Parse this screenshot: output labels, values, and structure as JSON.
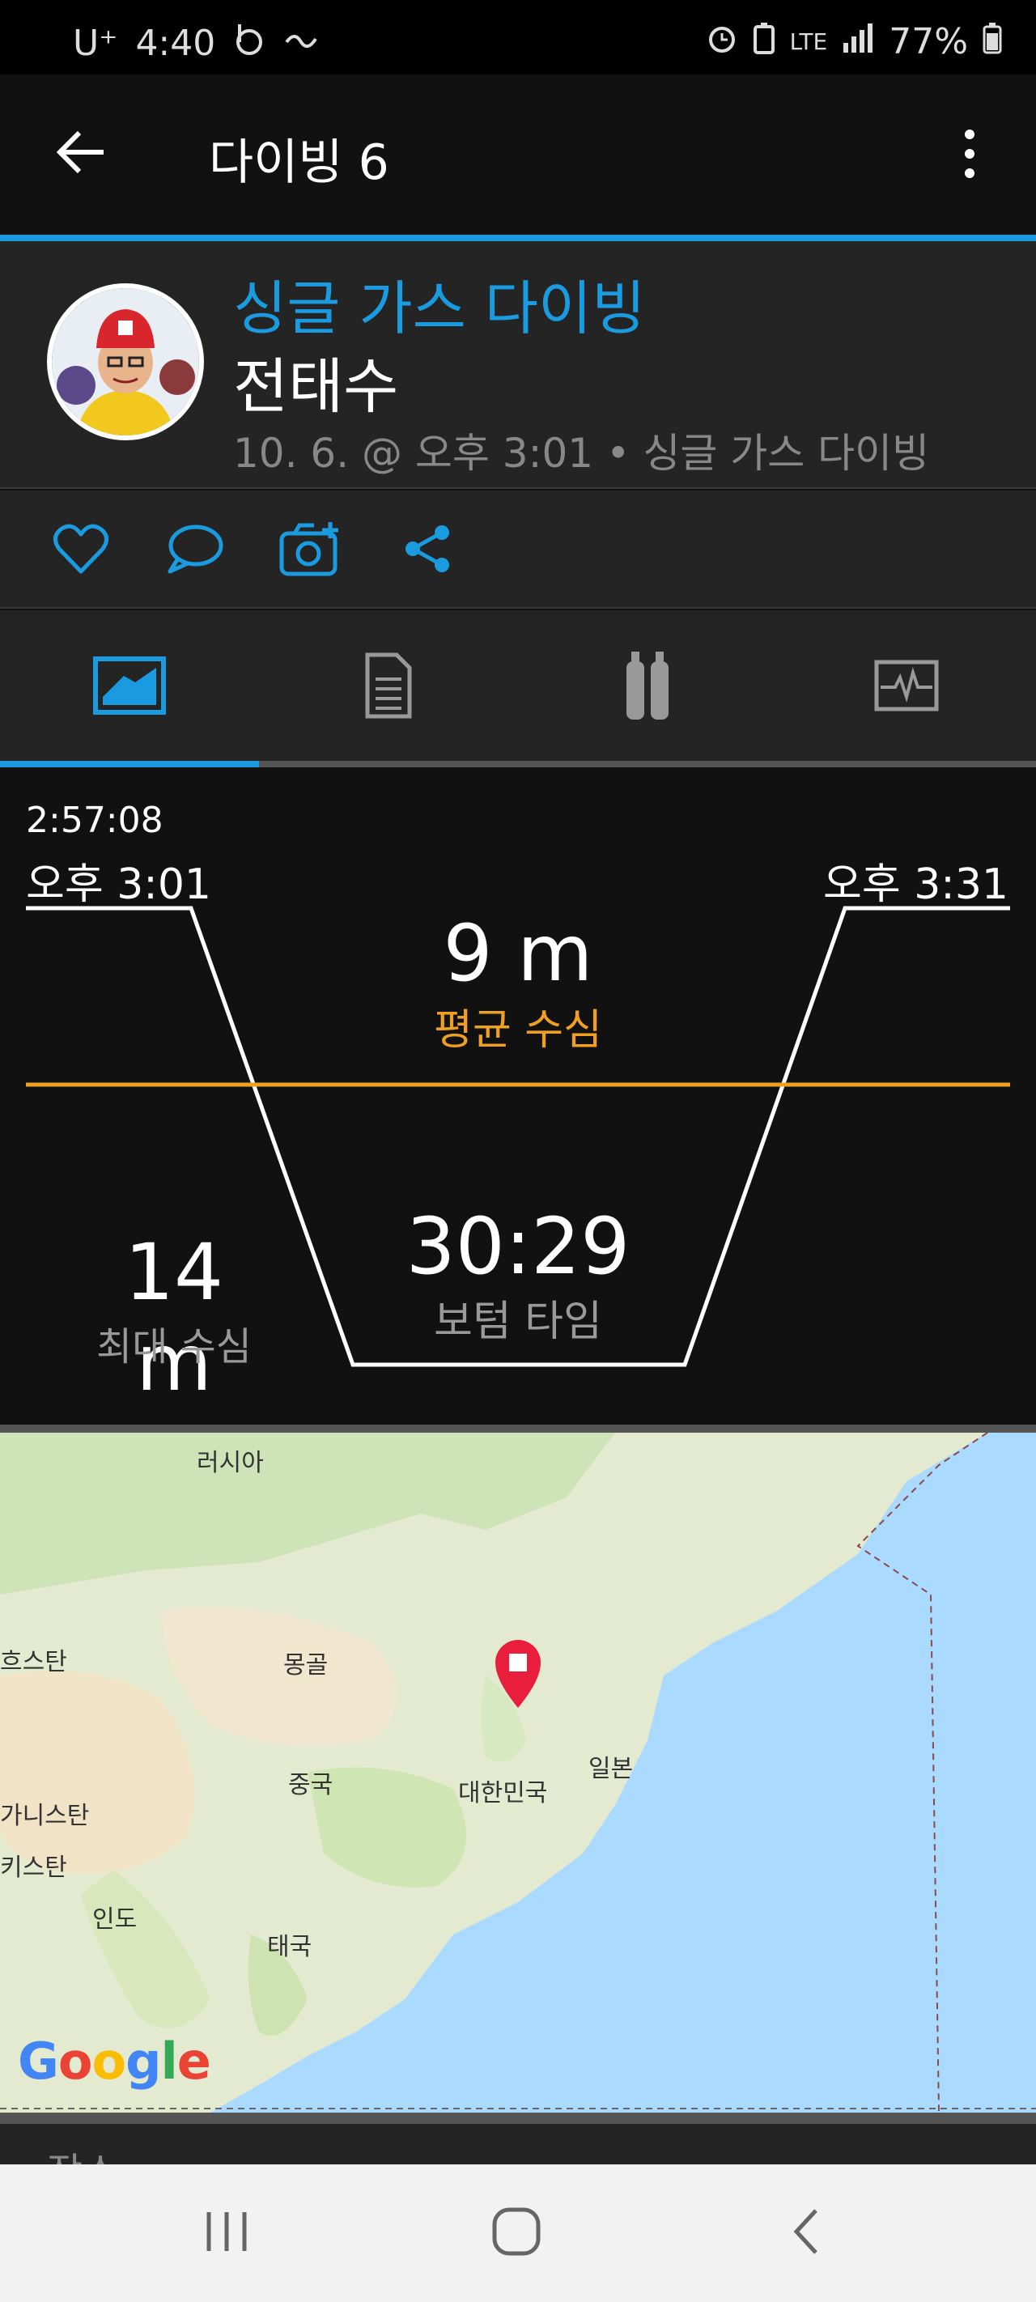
{
  "status_bar": {
    "carrier": "U⁺",
    "time": "4:40",
    "network": "LTE",
    "battery": "77%"
  },
  "app_bar": {
    "title": "다이빙 6"
  },
  "activity": {
    "type": "싱글 가스 다이빙",
    "user": "전태수",
    "meta": "10. 6. @ 오후 3:01 • 싱글 가스 다이빙"
  },
  "actions": [
    {
      "icon": "heart-icon"
    },
    {
      "icon": "comment-icon"
    },
    {
      "icon": "add-photo-icon"
    },
    {
      "icon": "share-icon"
    }
  ],
  "tabs": [
    {
      "icon": "dive-profile-icon",
      "selected": true
    },
    {
      "icon": "details-icon",
      "selected": false
    },
    {
      "icon": "gas-tanks-icon",
      "selected": false
    },
    {
      "icon": "chart-icon",
      "selected": false
    }
  ],
  "dive": {
    "elapsed": "2:57:08",
    "start_time": "오후 3:01",
    "end_time": "오후 3:31",
    "avg_depth_value": "9 m",
    "avg_depth_label": "평균 수심",
    "max_depth_value": "14 m",
    "max_depth_label": "최대 수심",
    "bottom_time_value": "30:29",
    "bottom_time_label": "보텀 타임"
  },
  "map": {
    "labels": {
      "russia": "러시아",
      "kazakhstan": "흐스탄",
      "mongolia": "몽골",
      "china": "중국",
      "korea": "대한민국",
      "japan": "일본",
      "afghanistan": "가니스탄",
      "pakistan": "키스탄",
      "india": "인도",
      "thailand": "태국"
    },
    "logo": "Google"
  },
  "section": {
    "place_label": "장소"
  },
  "colors": {
    "accent": "#1a9be0",
    "avg_depth": "#f0a020",
    "background": "#111111",
    "panel": "#242424"
  }
}
